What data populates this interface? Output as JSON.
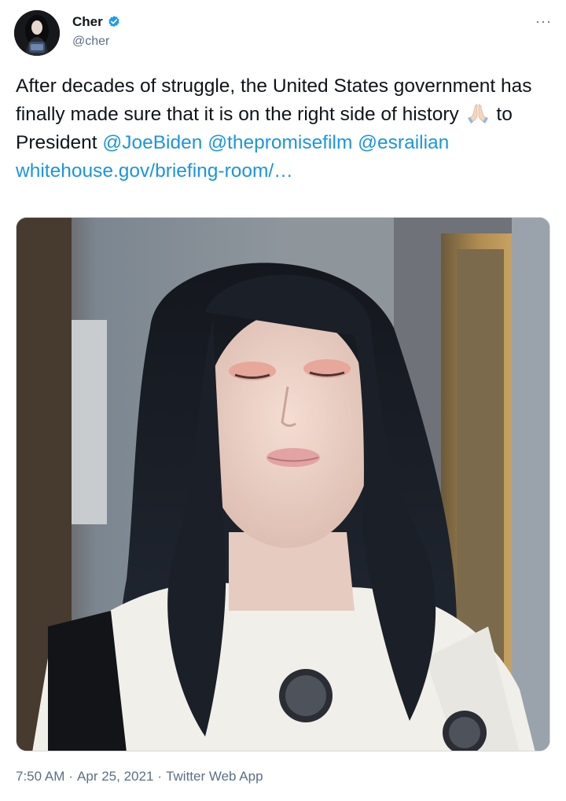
{
  "author": {
    "name": "Cher",
    "handle": "@cher",
    "verified": true,
    "verified_color": "#1d9bf0"
  },
  "menu": {
    "more_icon": "ellipsis-icon",
    "more_label": "···"
  },
  "tweet": {
    "text_part1": "After decades of struggle, the United States government has finally made sure that it is on the right side of history",
    "emoji": "folded-hands-emoji",
    "text_part2": "to President",
    "mention_1": "@JoeBiden",
    "mention_2": "@thepromisefilm",
    "mention_3": "@esrailian",
    "link": "whitehouse.gov/briefing-room/…",
    "link_color": "#1b95e0"
  },
  "media": {
    "type": "video-thumbnail"
  },
  "footer": {
    "time": "7:50 AM",
    "date": "Apr 25, 2021",
    "source": "Twitter Web App",
    "separator": "·"
  }
}
